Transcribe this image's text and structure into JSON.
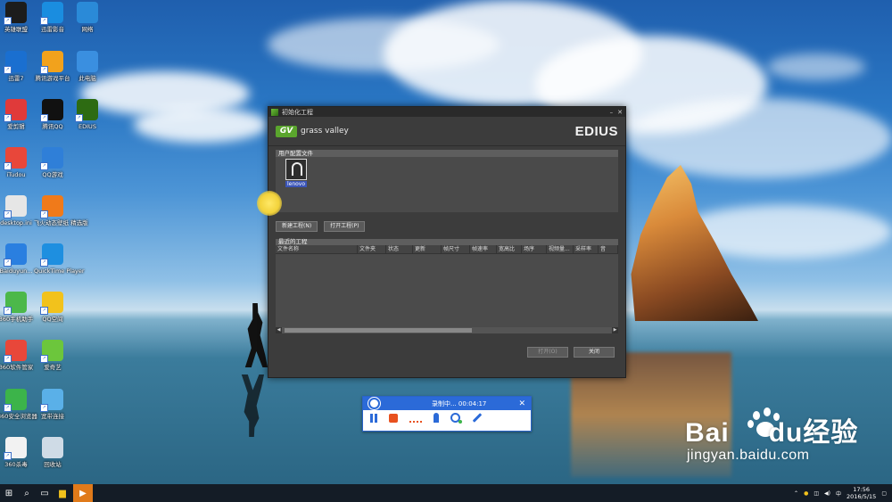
{
  "desktop": {
    "icons": [
      {
        "label": "英雄联盟",
        "icon": "league-of-legends-icon",
        "color": "#1c1c1c"
      },
      {
        "label": "迅雷影音",
        "icon": "xunlei-player-icon",
        "color": "#1a8de0"
      },
      {
        "label": "网络",
        "icon": "network-icon",
        "color": "#2a8ad8"
      },
      {
        "label": "迅雷7",
        "icon": "xunlei-icon",
        "color": "#1a6fd0"
      },
      {
        "label": "腾讯游戏平台",
        "icon": "tencent-games-icon",
        "color": "#f2a21c"
      },
      {
        "label": "此电脑",
        "icon": "this-pc-icon",
        "color": "#3a8fe0"
      },
      {
        "label": "爱剪辑",
        "icon": "aijianji-icon",
        "color": "#e03a3a"
      },
      {
        "label": "腾讯QQ",
        "icon": "qq-icon",
        "color": "#111111"
      },
      {
        "label": "EDIUS",
        "icon": "edius-icon",
        "color": "#2d6b12"
      },
      {
        "label": "iTudou",
        "icon": "itudou-icon",
        "color": "#e8473a"
      },
      {
        "label": "QQ游戏",
        "icon": "qq-game-icon",
        "color": "#2f7fd8"
      },
      {
        "label": "desktop.ini",
        "icon": "file-icon",
        "color": "#e6e6e6"
      },
      {
        "label": "飞火动态壁纸 精选版",
        "icon": "feihuo-wallpaper-icon",
        "color": "#f07a1a"
      },
      {
        "label": "Baiduyun...",
        "icon": "baiduyun-icon",
        "color": "#2a7fe0"
      },
      {
        "label": "QuickTime Player",
        "icon": "quicktime-icon",
        "color": "#1e8fe0"
      },
      {
        "label": "360手机助手",
        "icon": "360-assistant-icon",
        "color": "#4cb84a"
      },
      {
        "label": "QQ空间",
        "icon": "qzone-icon",
        "color": "#f2c21c"
      },
      {
        "label": "360软件管家",
        "icon": "360-software-icon",
        "color": "#e8473a"
      },
      {
        "label": "爱奇艺",
        "icon": "iqiyi-icon",
        "color": "#6cc63c"
      },
      {
        "label": "360安全浏览器",
        "icon": "360-browser-icon",
        "color": "#3cb44a"
      },
      {
        "label": "宽带连接",
        "icon": "broadband-icon",
        "color": "#5ab0e8"
      },
      {
        "label": "360杀毒",
        "icon": "360-antivirus-icon",
        "color": "#f2f2f2"
      },
      {
        "label": "回收站",
        "icon": "recycle-bin-icon",
        "color": "#cfdbe6"
      }
    ]
  },
  "edius_dialog": {
    "title": "初始化工程",
    "brand_left": "grass valley",
    "brand_logo": "GV",
    "brand_right": "EDIUS",
    "profile_section": "用户配置文件",
    "profile_name": "lenovo",
    "new_project": "新建工程(N)",
    "open_project": "打开工程(P)",
    "recent_section": "最近的工程",
    "columns": [
      "文件名称",
      "文件夹",
      "状态",
      "更新",
      "帧尺寸",
      "帧速率",
      "宽高比",
      "场序",
      "视频量...",
      "采样率",
      "音"
    ],
    "open_button": "打开(O)",
    "close_button": "关闭",
    "accent": "#5aa52d"
  },
  "recorder": {
    "status": "录制中...",
    "time": "00:04:17",
    "accent": "#2b6ad8",
    "tools": [
      "pause-icon",
      "stop-icon",
      "line-icon",
      "mic-icon",
      "webcam-icon",
      "pen-icon"
    ]
  },
  "watermark": {
    "brand": "Bai",
    "brand2": "du",
    "cn": "经验",
    "url": "jingyan.baidu.com"
  },
  "taskbar": {
    "time": "17:56",
    "date": "2016/5/15"
  }
}
